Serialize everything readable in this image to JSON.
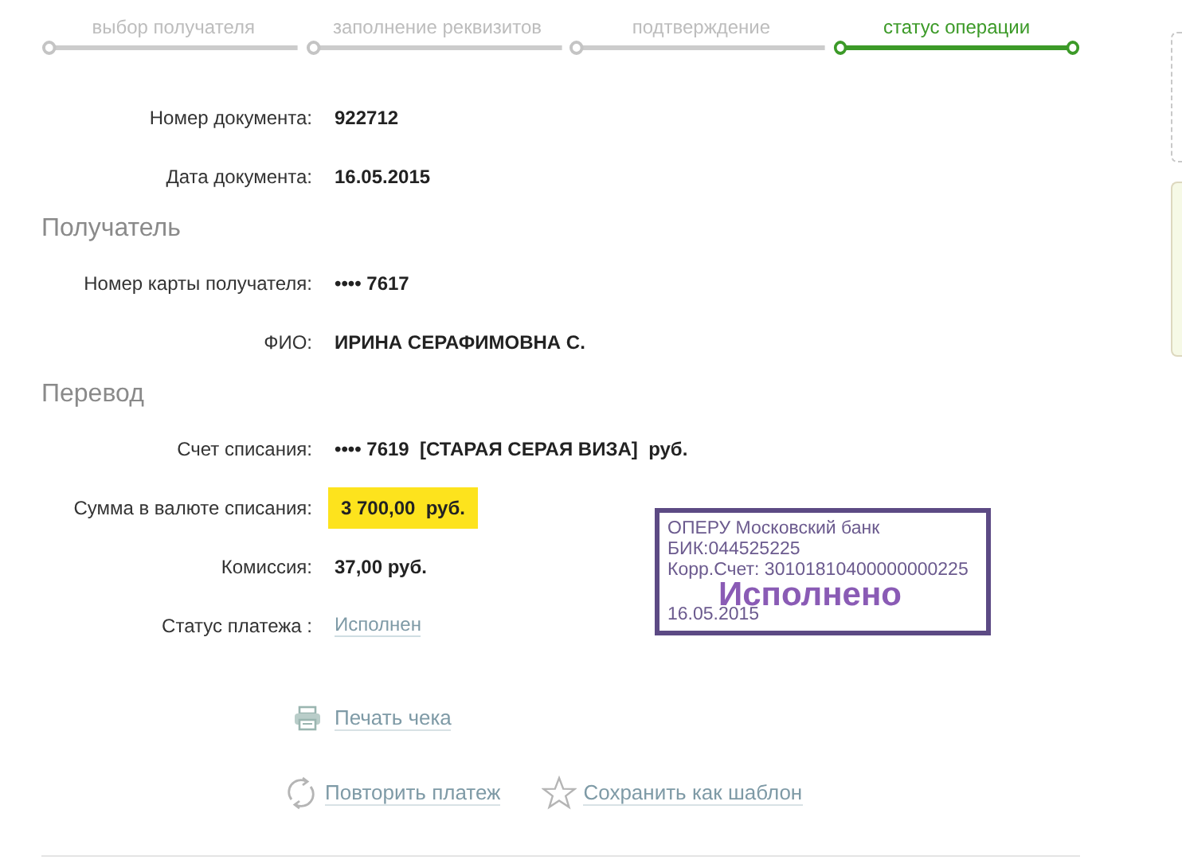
{
  "steps": [
    {
      "label": "выбор получателя",
      "selected": false
    },
    {
      "label": "заполнение реквизитов",
      "selected": false
    },
    {
      "label": "подтверждение",
      "selected": false
    },
    {
      "label": "статус операции",
      "selected": true
    }
  ],
  "sections": [
    {
      "rows": [
        {
          "label": "Номер документа:",
          "value": "922712",
          "kind": "text"
        },
        {
          "label": "Дата документа:",
          "value": "16.05.2015",
          "kind": "text"
        }
      ]
    },
    {
      "title": "Получатель",
      "rows": [
        {
          "label": "Номер карты получателя:",
          "value": "•••• 7617",
          "kind": "text"
        },
        {
          "label": "ФИО:",
          "value": "ИРИНА СЕРАФИМОВНА С.",
          "kind": "text"
        }
      ]
    },
    {
      "title": "Перевод",
      "rows": [
        {
          "label": "Счет списания:",
          "value": "•••• 7619  [СТАРАЯ СЕРАЯ ВИЗА]  руб.",
          "kind": "text"
        },
        {
          "label": "Сумма в валюте списания:",
          "value": "3 700,00  руб.",
          "kind": "highlight"
        },
        {
          "label": "Комиссия:",
          "value": "37,00 руб.",
          "kind": "text"
        },
        {
          "label": "Статус платежа :",
          "value": "Исполнен",
          "kind": "link"
        }
      ]
    }
  ],
  "stamp": {
    "lines": [
      "ОПЕРУ Московский банк",
      "БИК:044525225",
      "Корр.Счет: 30101810400000000225"
    ],
    "status": "Исполнено",
    "date": "16.05.2015"
  },
  "print": {
    "label": "Печать чека",
    "kind": "print"
  },
  "actions": [
    {
      "label": "Повторить платеж",
      "kind": "repeat"
    },
    {
      "label": "Сохранить как шаблон",
      "kind": "save"
    }
  ]
}
